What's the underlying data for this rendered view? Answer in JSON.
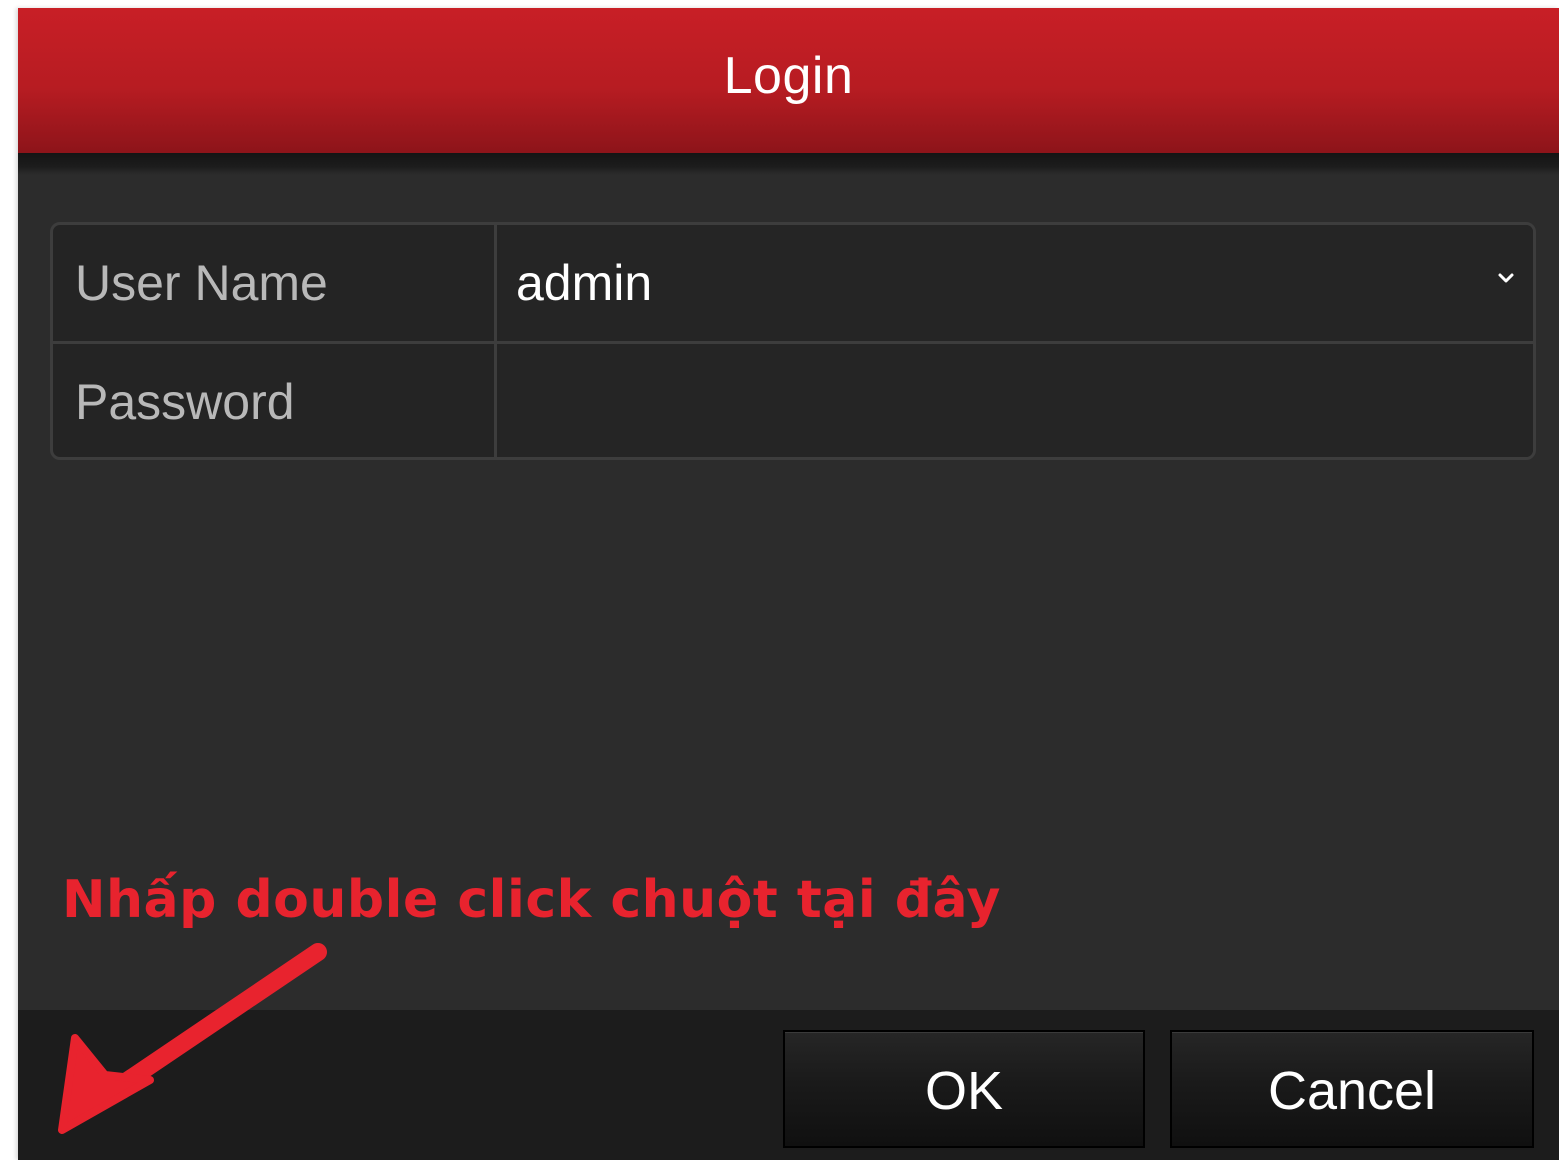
{
  "dialog": {
    "title": "Login",
    "accent_color": "#c81f26"
  },
  "form": {
    "username_label": "User Name",
    "username_value": "admin",
    "password_label": "Password",
    "password_value": ""
  },
  "annotation": {
    "text": "Nhấp double click chuột tại đây",
    "color": "#e8232e"
  },
  "buttons": {
    "ok_label": "OK",
    "cancel_label": "Cancel"
  },
  "icons": {
    "dropdown": "chevron-down-icon",
    "annotation_arrow": "arrow-icon"
  }
}
